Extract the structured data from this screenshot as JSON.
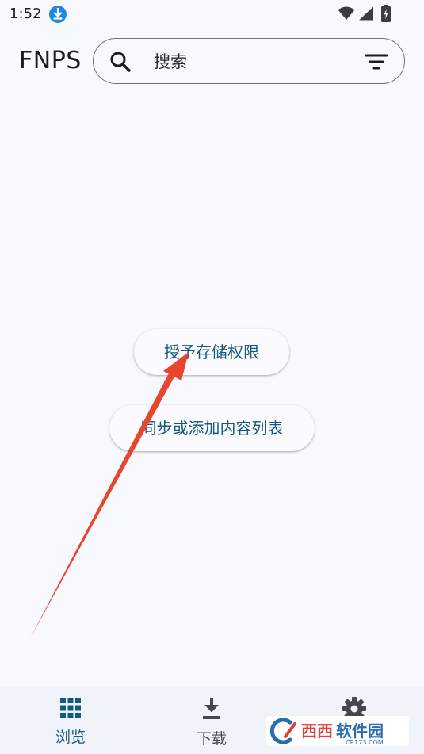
{
  "status_bar": {
    "time": "1:52",
    "icons": [
      "download-notification-icon",
      "wifi-icon",
      "signal-icon",
      "battery-charging-icon"
    ]
  },
  "header": {
    "title": "FNPS",
    "search": {
      "placeholder": "搜索",
      "value": ""
    }
  },
  "actions": {
    "grant_permission": "授予存储权限",
    "sync_list": "同步或添加内容列表"
  },
  "bottom_nav": {
    "items": [
      {
        "label": "浏览",
        "icon": "grid-icon",
        "active": true
      },
      {
        "label": "下载",
        "icon": "download-icon",
        "active": false
      },
      {
        "label": "设置",
        "icon": "gear-icon",
        "active": false
      }
    ]
  },
  "watermark": {
    "text": "西西软件园",
    "subtext": "CR173.COM"
  },
  "colors": {
    "background": "#f8f9fe",
    "accent": "#135a7d",
    "annotation": "#e8452f",
    "nav_background": "#f0f3fa"
  }
}
